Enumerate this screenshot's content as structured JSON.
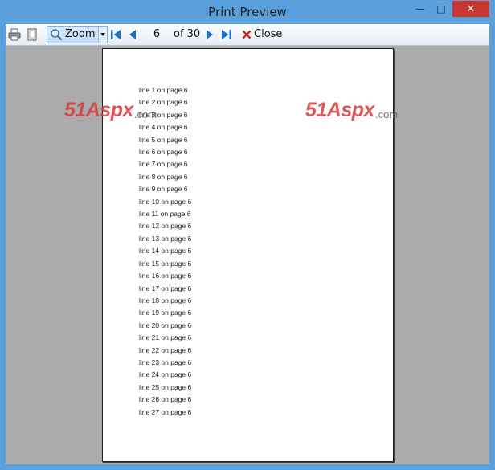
{
  "window": {
    "title": "Print Preview",
    "min_symbol": "—",
    "max_symbol": "□",
    "close_symbol": "✕"
  },
  "toolbar": {
    "zoom_label": "Zoom",
    "page_value": "6",
    "page_total_text": "of 30",
    "close_label": "Close"
  },
  "document": {
    "lines": [
      "line 1 on page 6",
      "line 2 on page 6",
      "line 3 on page 6",
      "line 4 on page 6",
      "line 5 on page 6",
      "line 6 on page 6",
      "line 7 on page 6",
      "line 8 on page 6",
      "line 9 on page 6",
      "line 10 on page 6",
      "line 11 on page 6",
      "line 12 on page 6",
      "line 13 on page 6",
      "line 14 on page 6",
      "line 15 on page 6",
      "line 16 on page 6",
      "line 17 on page 6",
      "line 18 on page 6",
      "line 19 on page 6",
      "line 20 on page 6",
      "line 21 on page 6",
      "line 22 on page 6",
      "line 23 on page 6",
      "line 24 on page 6",
      "line 25 on page 6",
      "line 26 on page 6",
      "line 27 on page 6"
    ]
  },
  "watermark": {
    "brand": "51Aspx",
    "suffix": ".com"
  },
  "colors": {
    "titlebar": "#59a0dc",
    "close_button": "#c7372f",
    "preview_background": "#ababab",
    "nav_arrows": "#1a6fc9"
  }
}
